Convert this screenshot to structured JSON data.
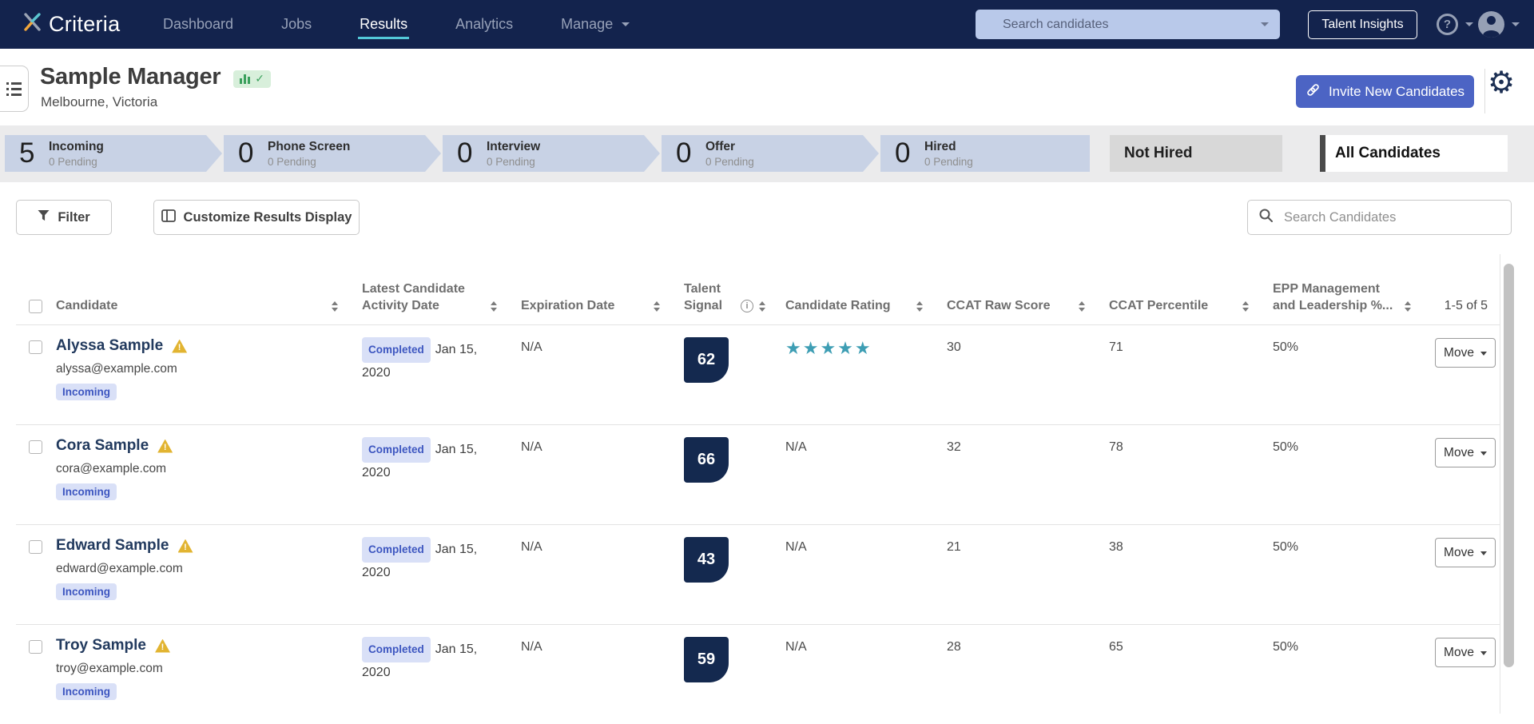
{
  "navbar": {
    "brand": "Criteria",
    "items": [
      {
        "label": "Dashboard",
        "active": false
      },
      {
        "label": "Jobs",
        "active": false
      },
      {
        "label": "Results",
        "active": true
      },
      {
        "label": "Analytics",
        "active": false
      },
      {
        "label": "Manage",
        "active": false
      }
    ],
    "search_placeholder": "Search candidates",
    "talent_insights_label": "Talent Insights"
  },
  "header": {
    "title": "Sample Manager",
    "subtitle": "Melbourne, Victoria",
    "invite_button_label": "Invite New Candidates"
  },
  "pipeline": {
    "stages": [
      {
        "count": "5",
        "label": "Incoming",
        "sub": "0 Pending"
      },
      {
        "count": "0",
        "label": "Phone Screen",
        "sub": "0 Pending"
      },
      {
        "count": "0",
        "label": "Interview",
        "sub": "0 Pending"
      },
      {
        "count": "0",
        "label": "Offer",
        "sub": "0 Pending"
      },
      {
        "count": "0",
        "label": "Hired",
        "sub": "0 Pending"
      }
    ],
    "not_hired_label": "Not Hired",
    "all_candidates_label": "All Candidates"
  },
  "toolbar": {
    "filter_label": "Filter",
    "customize_label": "Customize Results Display",
    "search_placeholder": "Search Candidates"
  },
  "table": {
    "columns": [
      {
        "line1": "Candidate"
      },
      {
        "line1": "Latest Candidate",
        "line2": "Activity Date"
      },
      {
        "line1": "Expiration Date"
      },
      {
        "line1": "Talent",
        "line2": "Signal"
      },
      {
        "line1": "Candidate Rating"
      },
      {
        "line1": "CCAT Raw Score"
      },
      {
        "line1": "CCAT Percentile"
      },
      {
        "line1": "EPP Management",
        "line2": "and Leadership %..."
      }
    ],
    "pagination": "1-5 of 5",
    "rows": [
      {
        "name": "Alyssa Sample",
        "email": "alyssa@example.com",
        "stage": "Incoming",
        "status": "Completed",
        "date": "Jan 15, 2020",
        "expiration": "N/A",
        "talent_signal": "62",
        "rating": "★★★★★",
        "ccat_raw": "30",
        "ccat_percentile": "71",
        "epp_score": "50%",
        "move": "Move"
      },
      {
        "name": "Cora Sample",
        "email": "cora@example.com",
        "stage": "Incoming",
        "status": "Completed",
        "date": "Jan 15, 2020",
        "expiration": "N/A",
        "talent_signal": "66",
        "rating": "N/A",
        "ccat_raw": "32",
        "ccat_percentile": "78",
        "epp_score": "50%",
        "move": "Move"
      },
      {
        "name": "Edward Sample",
        "email": "edward@example.com",
        "stage": "Incoming",
        "status": "Completed",
        "date": "Jan 15, 2020",
        "expiration": "N/A",
        "talent_signal": "43",
        "rating": "N/A",
        "ccat_raw": "21",
        "ccat_percentile": "38",
        "epp_score": "50%",
        "move": "Move"
      },
      {
        "name": "Troy Sample",
        "email": "troy@example.com",
        "stage": "Incoming",
        "status": "Completed",
        "date": "Jan 15, 2020",
        "expiration": "N/A",
        "talent_signal": "59",
        "rating": "N/A",
        "ccat_raw": "28",
        "ccat_percentile": "65",
        "epp_score": "50%",
        "move": "Move"
      }
    ]
  },
  "colors": {
    "navbar_bg": "#13234d",
    "accent_teal": "#53c8d8",
    "primary_button": "#4c64c4",
    "signal_badge": "#14294f",
    "stage_chip": "#c8d2e5",
    "badge_bg": "#d9e0f7",
    "badge_text": "#3d56c0",
    "star": "#3e9eb4",
    "warning": "#e2b431",
    "active_badge_green": "#3aa05c"
  }
}
